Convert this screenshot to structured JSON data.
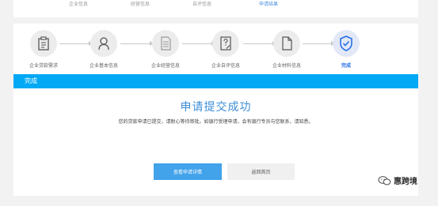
{
  "top_tabs": [
    {
      "label": "企业信息"
    },
    {
      "label": "经营信息"
    },
    {
      "label": "自评信息"
    },
    {
      "label": "申请结果"
    }
  ],
  "steps": [
    {
      "label": "企业贷款需求",
      "icon": "clipboard-icon"
    },
    {
      "label": "企业基本信息",
      "icon": "person-icon"
    },
    {
      "label": "企业经营信息",
      "icon": "document-list-icon"
    },
    {
      "label": "企业自评信息",
      "icon": "edit-document-icon"
    },
    {
      "label": "企业材料信息",
      "icon": "file-icon"
    },
    {
      "label": "完成",
      "icon": "shield-check-icon"
    }
  ],
  "banner": {
    "title": "完成"
  },
  "result": {
    "title": "申请提交成功",
    "message": "您的贷款申请已提交，请耐心等待审批。如银行受理申请，会有银行专员与您联系，请知悉。"
  },
  "buttons": {
    "primary": "查看申请详情",
    "secondary": "返回首页"
  },
  "watermark": {
    "text": "惠跨境"
  },
  "colors": {
    "accent": "#03a9f4",
    "primary_button": "#42a2ea",
    "title": "#3d8ed9",
    "active_step": "#1e6ae6"
  }
}
